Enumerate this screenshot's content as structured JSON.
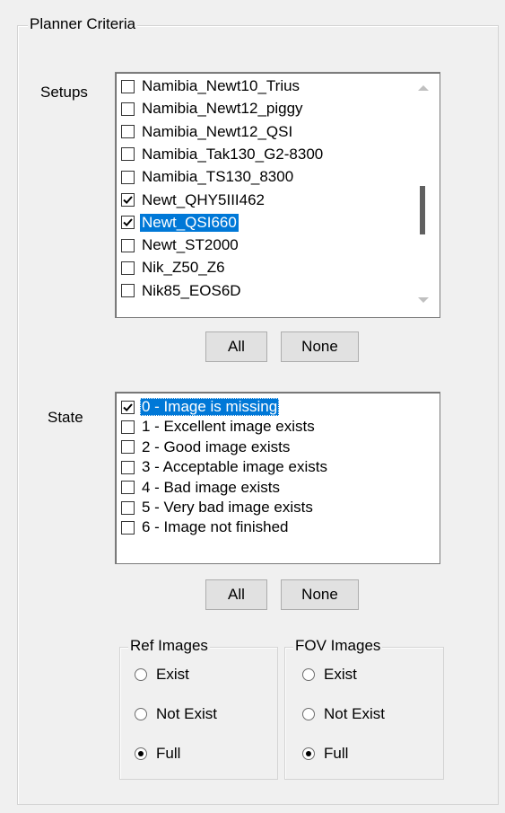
{
  "panel": {
    "title": "Planner Criteria"
  },
  "setups": {
    "label": "Setups",
    "items": [
      {
        "label": "Namibia_Newt10_Trius",
        "checked": false
      },
      {
        "label": "Namibia_Newt12_piggy",
        "checked": false
      },
      {
        "label": "Namibia_Newt12_QSI",
        "checked": false
      },
      {
        "label": "Namibia_Tak130_G2-8300",
        "checked": false
      },
      {
        "label": "Namibia_TS130_8300",
        "checked": false
      },
      {
        "label": "Newt_QHY5III462",
        "checked": true
      },
      {
        "label": "Newt_QSI660",
        "checked": true,
        "selected": true
      },
      {
        "label": "Newt_ST2000",
        "checked": false
      },
      {
        "label": "Nik_Z50_Z6",
        "checked": false
      },
      {
        "label": "Nik85_EOS6D",
        "checked": false
      }
    ],
    "all_label": "All",
    "none_label": "None"
  },
  "state": {
    "label": "State",
    "items": [
      {
        "label": "0 - Image is missing",
        "checked": true,
        "selected": true
      },
      {
        "label": "1 - Excellent image exists",
        "checked": false
      },
      {
        "label": "2 - Good image exists",
        "checked": false
      },
      {
        "label": "3 - Acceptable image exists",
        "checked": false
      },
      {
        "label": "4 - Bad image exists",
        "checked": false
      },
      {
        "label": "5 - Very bad image exists",
        "checked": false
      },
      {
        "label": "6 - Image not finished",
        "checked": false
      }
    ],
    "all_label": "All",
    "none_label": "None"
  },
  "ref_images": {
    "title": "Ref Images",
    "options": [
      "Exist",
      "Not Exist",
      "Full"
    ],
    "selected": "Full"
  },
  "fov_images": {
    "title": "FOV Images",
    "options": [
      "Exist",
      "Not Exist",
      "Full"
    ],
    "selected": "Full"
  },
  "colors": {
    "selection": "#0078d7",
    "background": "#f0f0f0"
  }
}
